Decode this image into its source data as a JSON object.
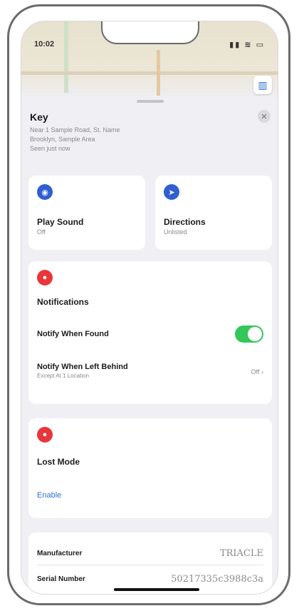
{
  "status_bar": {
    "time": "10:02",
    "icons": "▮▮ ≋ ▭"
  },
  "map": {
    "map_button_icon": "map-icon"
  },
  "header": {
    "title": "Key",
    "subtitle_line1": "Near 1 Sample Road, St. Name",
    "subtitle_line2": "Brooklyn, Sample Area",
    "subtitle_line3": "Seen just now",
    "close_symbol": "✕"
  },
  "actions": [
    {
      "title": "Play Sound",
      "subtitle": "Off",
      "icon": "speaker-icon",
      "icon_symbol": "◉",
      "color": "#2f5fd0"
    },
    {
      "title": "Directions",
      "subtitle": "Unlisted",
      "icon": "directions-icon",
      "icon_symbol": "➤",
      "color": "#2f5fd0"
    }
  ],
  "notifications": {
    "section_title": "Notifications",
    "icon_symbol": "●",
    "notify_when_found": {
      "label": "Notify When Found",
      "enabled": true
    },
    "notify_when_left_behind": {
      "label": "Notify When Left Behind",
      "sublabel": "Except At 1 Location",
      "value": "Off ›"
    }
  },
  "lost_mode": {
    "section_title": "Lost Mode",
    "icon_symbol": "●",
    "action_label": "Enable"
  },
  "info": [
    {
      "key": "Manufacturer",
      "value": "TRIACLE"
    },
    {
      "key": "Serial Number",
      "value": "50217335c3988c3a"
    }
  ]
}
